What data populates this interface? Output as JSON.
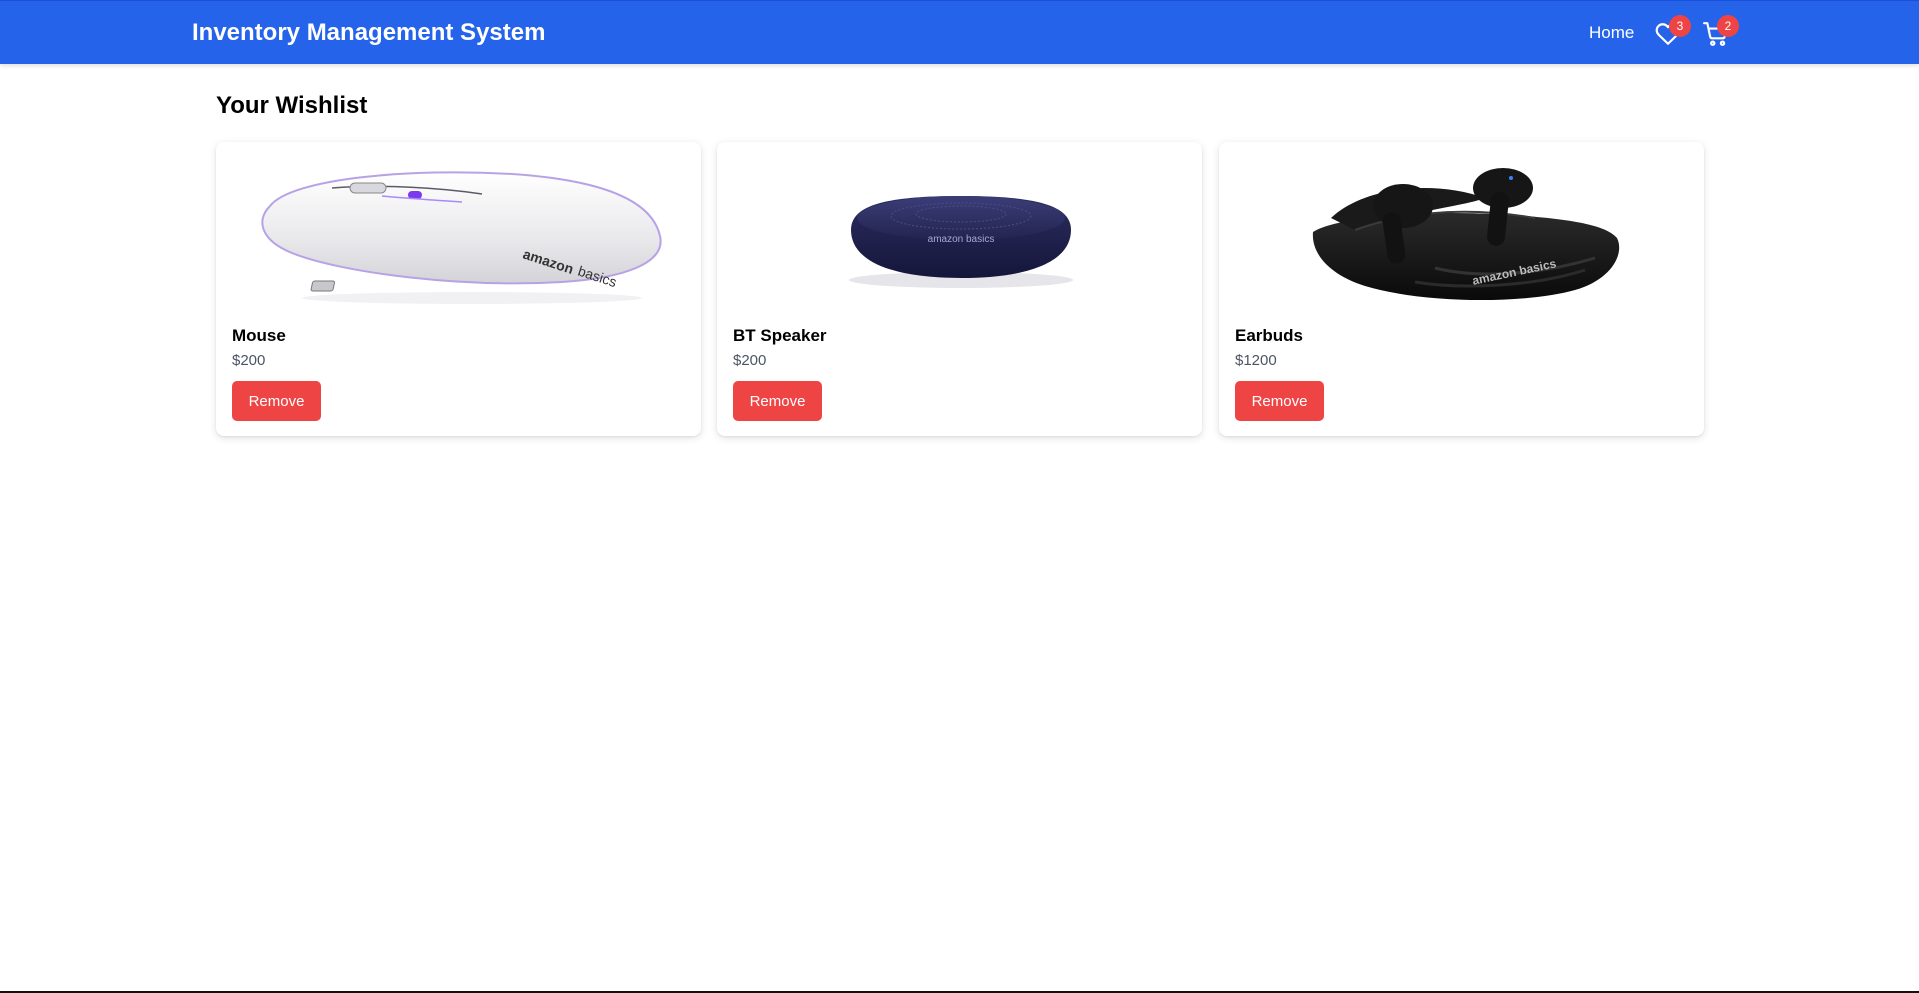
{
  "navbar": {
    "brand": "Inventory Management System",
    "home_label": "Home",
    "wishlist": {
      "icon": "heart-icon",
      "count": "3"
    },
    "cart": {
      "icon": "cart-icon",
      "count": "2"
    },
    "colors": {
      "background": "#2563eb",
      "badge": "#ef4444"
    }
  },
  "page": {
    "title": "Your Wishlist"
  },
  "wishlist": {
    "items": [
      {
        "name": "Mouse",
        "price": "$200",
        "remove_label": "Remove",
        "image": "mouse-image"
      },
      {
        "name": "BT Speaker",
        "price": "$200",
        "remove_label": "Remove",
        "image": "speaker-image"
      },
      {
        "name": "Earbuds",
        "price": "$1200",
        "remove_label": "Remove",
        "image": "earbuds-image"
      }
    ]
  },
  "colors": {
    "remove_button": "#ef4444",
    "price_text": "#4b5563"
  }
}
